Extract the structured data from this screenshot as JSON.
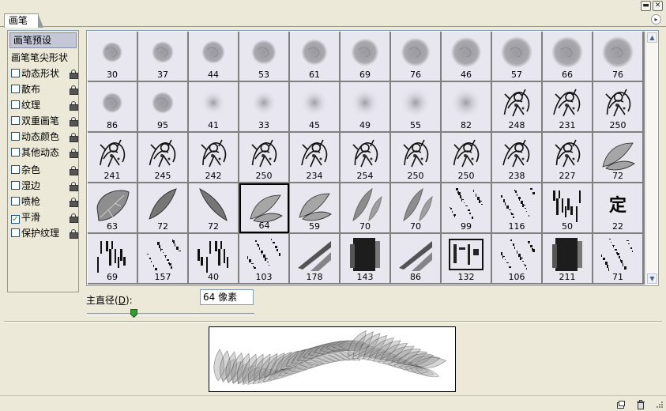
{
  "window": {
    "minimize_glyph": "▬",
    "close_glyph": "✕"
  },
  "tab": {
    "label": "画笔"
  },
  "panel_menu_glyph": "▸",
  "options": {
    "presets": "画笔预设",
    "tip_shape": "画笔笔尖形状",
    "items": [
      {
        "label": "动态形状",
        "checked": false
      },
      {
        "label": "散布",
        "checked": false
      },
      {
        "label": "纹理",
        "checked": false
      },
      {
        "label": "双重画笔",
        "checked": false
      },
      {
        "label": "动态颜色",
        "checked": false
      },
      {
        "label": "其他动态",
        "checked": false
      },
      {
        "label": "杂色",
        "checked": false
      },
      {
        "label": "湿边",
        "checked": false
      },
      {
        "label": "喷枪",
        "checked": false
      },
      {
        "label": "平滑",
        "checked": true
      },
      {
        "label": "保护纹理",
        "checked": false
      }
    ],
    "check_glyph": "✓"
  },
  "brushes": [
    {
      "size": "30",
      "kind": "soft-round"
    },
    {
      "size": "37",
      "kind": "soft-round"
    },
    {
      "size": "44",
      "kind": "soft-round"
    },
    {
      "size": "53",
      "kind": "soft-round"
    },
    {
      "size": "61",
      "kind": "soft-round"
    },
    {
      "size": "69",
      "kind": "soft-round"
    },
    {
      "size": "76",
      "kind": "soft-round"
    },
    {
      "size": "46",
      "kind": "soft-round"
    },
    {
      "size": "57",
      "kind": "soft-round"
    },
    {
      "size": "66",
      "kind": "soft-round"
    },
    {
      "size": "76",
      "kind": "soft-round"
    },
    {
      "size": "86",
      "kind": "soft-round"
    },
    {
      "size": "95",
      "kind": "soft-round"
    },
    {
      "size": "41",
      "kind": "airbrush"
    },
    {
      "size": "33",
      "kind": "airbrush"
    },
    {
      "size": "45",
      "kind": "airbrush"
    },
    {
      "size": "49",
      "kind": "airbrush"
    },
    {
      "size": "55",
      "kind": "airbrush"
    },
    {
      "size": "82",
      "kind": "airbrush"
    },
    {
      "size": "248",
      "kind": "sketch"
    },
    {
      "size": "231",
      "kind": "sketch"
    },
    {
      "size": "250",
      "kind": "sketch"
    },
    {
      "size": "241",
      "kind": "sketch"
    },
    {
      "size": "245",
      "kind": "sketch"
    },
    {
      "size": "242",
      "kind": "sketch"
    },
    {
      "size": "250",
      "kind": "sketch"
    },
    {
      "size": "234",
      "kind": "sketch"
    },
    {
      "size": "254",
      "kind": "sketch"
    },
    {
      "size": "250",
      "kind": "sketch"
    },
    {
      "size": "250",
      "kind": "sketch"
    },
    {
      "size": "238",
      "kind": "sketch"
    },
    {
      "size": "227",
      "kind": "sketch"
    },
    {
      "size": "72",
      "kind": "leaf-pair"
    },
    {
      "size": "63",
      "kind": "leaf-big"
    },
    {
      "size": "72",
      "kind": "leaf-slim-l"
    },
    {
      "size": "72",
      "kind": "leaf-slim-r"
    },
    {
      "size": "64",
      "kind": "leaf-pair",
      "selected": true
    },
    {
      "size": "59",
      "kind": "leaf-pair"
    },
    {
      "size": "70",
      "kind": "leaf-thin"
    },
    {
      "size": "70",
      "kind": "leaf-thin"
    },
    {
      "size": "99",
      "kind": "scatter"
    },
    {
      "size": "116",
      "kind": "scatter"
    },
    {
      "size": "50",
      "kind": "ink"
    },
    {
      "size": "22",
      "kind": "char",
      "char": "定"
    },
    {
      "size": "69",
      "kind": "ink"
    },
    {
      "size": "157",
      "kind": "scatter"
    },
    {
      "size": "40",
      "kind": "ink"
    },
    {
      "size": "103",
      "kind": "scatter"
    },
    {
      "size": "178",
      "kind": "dry"
    },
    {
      "size": "143",
      "kind": "block"
    },
    {
      "size": "86",
      "kind": "dry"
    },
    {
      "size": "132",
      "kind": "stamp"
    },
    {
      "size": "106",
      "kind": "scatter"
    },
    {
      "size": "211",
      "kind": "block"
    },
    {
      "size": "71",
      "kind": "scatter"
    }
  ],
  "diameter": {
    "label_prefix": "主直径(",
    "label_key": "D",
    "label_suffix": "):",
    "value": "64 像素",
    "slider_fraction": 0.28
  },
  "scroll": {
    "up_glyph": "▲",
    "down_glyph": "▼"
  }
}
